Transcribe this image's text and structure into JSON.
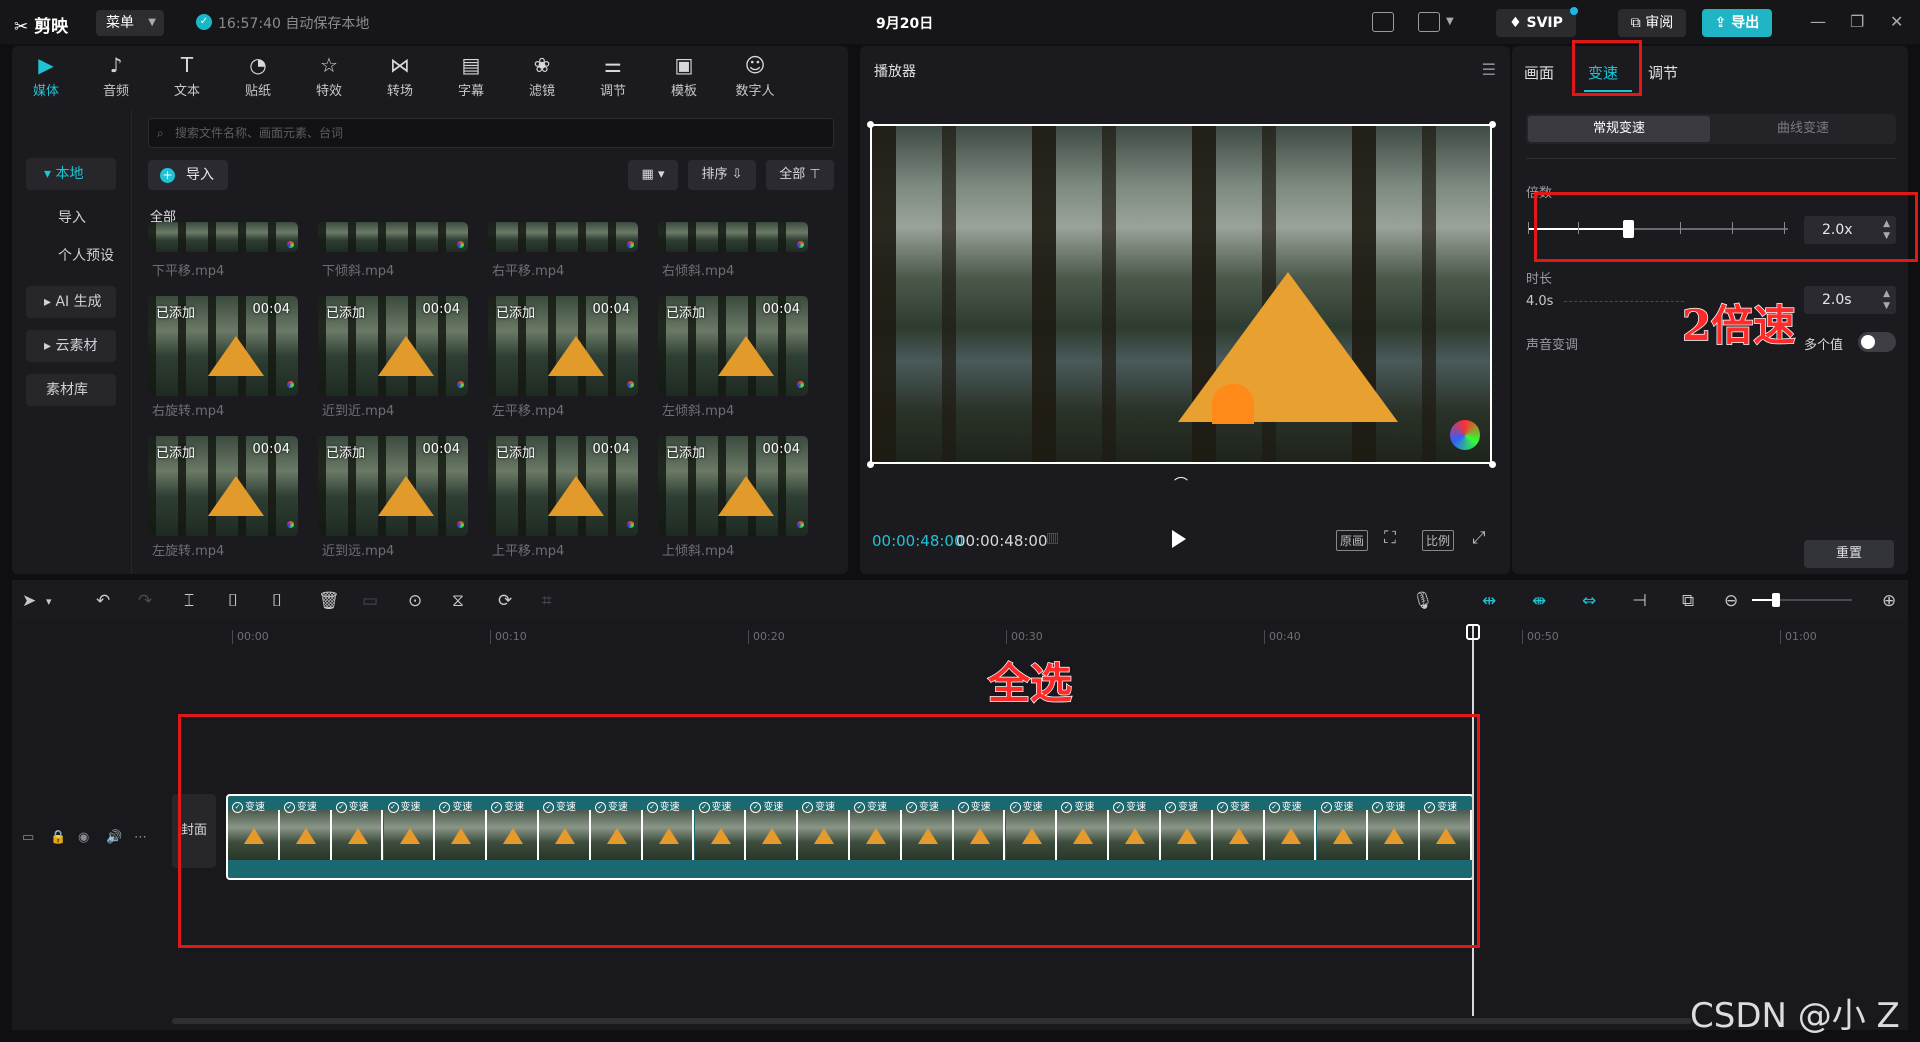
{
  "titlebar": {
    "app_name": "剪映",
    "menu_label": "菜单",
    "save_status": "16:57:40 自动保存本地",
    "date": "9月20日",
    "svip": "SVIP",
    "review": "审阅",
    "export": "导出"
  },
  "media_tabs": [
    {
      "label": "媒体",
      "icon": "media-icon"
    },
    {
      "label": "音频",
      "icon": "audio-icon"
    },
    {
      "label": "文本",
      "icon": "text-icon"
    },
    {
      "label": "贴纸",
      "icon": "sticker-icon"
    },
    {
      "label": "特效",
      "icon": "effects-icon"
    },
    {
      "label": "转场",
      "icon": "transition-icon"
    },
    {
      "label": "字幕",
      "icon": "subtitle-icon"
    },
    {
      "label": "滤镜",
      "icon": "filter-icon"
    },
    {
      "label": "调节",
      "icon": "adjust-icon"
    },
    {
      "label": "模板",
      "icon": "template-icon"
    },
    {
      "label": "数字人",
      "icon": "digital-human-icon"
    }
  ],
  "sidebar": {
    "local": "本地",
    "import": "导入",
    "personal_preset": "个人预设",
    "ai_gen": "AI 生成",
    "cloud": "云素材",
    "library": "素材库"
  },
  "library": {
    "search_placeholder": "搜索文件名称、画面元素、台词",
    "import_btn": "导入",
    "sort": "排序",
    "filter_all": "全部",
    "section_all": "全部",
    "added_label": "已添加",
    "duration": "00:04",
    "row0": [
      "下平移.mp4",
      "下倾斜.mp4",
      "右平移.mp4",
      "右倾斜.mp4"
    ],
    "row1": [
      "右旋转.mp4",
      "近到近.mp4",
      "左平移.mp4",
      "左倾斜.mp4"
    ],
    "row2": [
      "左旋转.mp4",
      "近到远.mp4",
      "上平移.mp4",
      "上倾斜.mp4"
    ]
  },
  "player": {
    "title": "播放器",
    "current_time": "00:00:48:00",
    "total_time": "00:00:48:00",
    "ctl_original": "原画",
    "ctl_ratio": "比例"
  },
  "properties": {
    "tab_picture": "画面",
    "tab_speed": "变速",
    "tab_adjust": "调节",
    "normal_speed": "常规变速",
    "curve_speed": "曲线变速",
    "multiplier_label": "倍数",
    "multiplier_value": "2.0x",
    "multiplier_level": 2.0,
    "duration_label": "时长",
    "duration_orig": "4.0s",
    "duration_value": "2.0s",
    "pitch_label": "声音变调",
    "multi_value": "多个值",
    "reset": "重置"
  },
  "timeline": {
    "ruler": [
      "00:00",
      "00:10",
      "00:20",
      "00:30",
      "00:40",
      "00:50",
      "01:00"
    ],
    "cover_label": "封面",
    "clip_badge": "变速",
    "clip_count": 24
  },
  "annotations": {
    "select_all": "全选",
    "double_speed": "2倍速",
    "annotation_color": "#e01818"
  },
  "watermark": "CSDN @小 Z",
  "colors": {
    "accent": "#1fc3d4",
    "export_bg": "#1fb5c4",
    "annotation": "#e01818"
  }
}
